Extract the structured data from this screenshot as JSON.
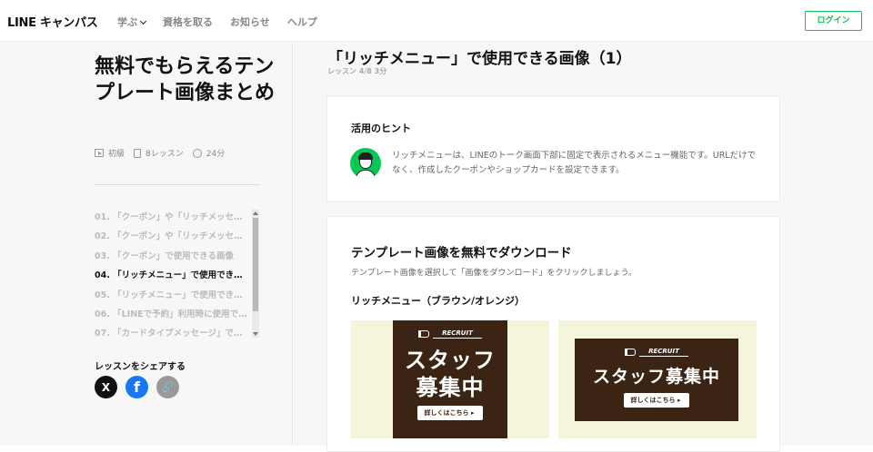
{
  "header": {
    "logo": "LINE キャンパス",
    "nav": [
      "学ぶ",
      "資格を取る",
      "お知らせ",
      "ヘルプ"
    ],
    "login": "ログイン"
  },
  "sidebar": {
    "title": "無料でもらえるテンプレート画像まとめ",
    "level": "初級",
    "lessons_count": "8レッスン",
    "duration": "24分",
    "lessons": [
      "01. 「クーポン」や「リッチメッセ…",
      "02. 「クーポン」や「リッチメッセ…",
      "03. 「クーポン」で使用できる画像",
      "04. 「リッチメニュー」で使用でき…",
      "05. 「リッチメニュー」で使用でき…",
      "06. 「LINEで予約」利用時に使用で…",
      "07. 「カードタイプメッセージ」で…"
    ],
    "share_label": "レッスンをシェアする",
    "social": [
      "X",
      "f",
      "🔗"
    ]
  },
  "main": {
    "title": "「リッチメニュー」で使用できる画像（1）",
    "subtitle": "レッスン 4/8 3分",
    "hint": {
      "title": "活用のヒント",
      "text": "リッチメニューは、LINEのトーク画面下部に固定で表示されるメニュー機能です。URLだけでなく、作成したクーポンやショップカードを設定できます。"
    },
    "download": {
      "title": "テンプレート画像を無料でダウンロード",
      "desc": "テンプレート画像を選択して「画像をダウンロード」をクリックしましょう。",
      "section": "リッチメニュー（ブラウン/オレンジ）",
      "images": [
        {
          "tag": "RECRUIT",
          "text_line1": "スタッフ",
          "text_line2": "募集中",
          "button": "詳しくはこちら"
        },
        {
          "tag": "RECRUIT",
          "text": "スタッフ募集中",
          "button": "詳しくはこちら"
        }
      ]
    }
  },
  "colors": {
    "accent": "#06c755",
    "banner": "#3b2414",
    "banner_bg": "#f5f5dc"
  }
}
